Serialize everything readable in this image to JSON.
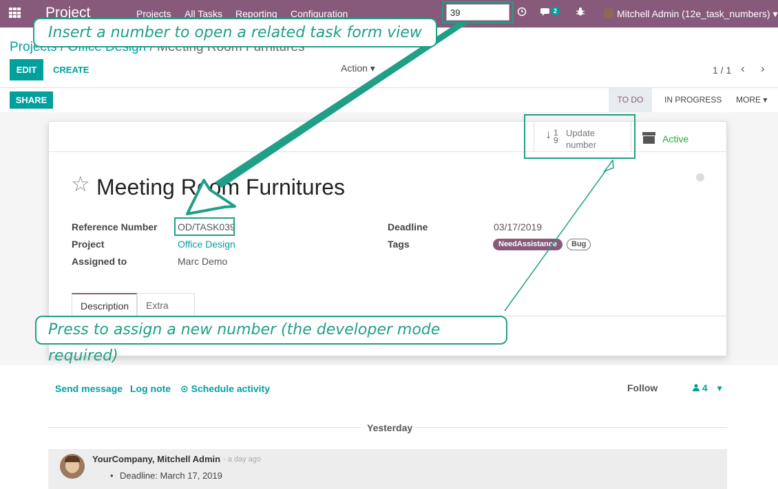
{
  "navbar": {
    "brand": "Project",
    "menu": [
      "Projects",
      "All Tasks",
      "Reporting",
      "Configuration"
    ],
    "quick_search_value": "39",
    "messages_count": "2",
    "user_name": "Mitchell Admin (12e_task_numbers)",
    "user_caret": "▾"
  },
  "breadcrumb": {
    "items": [
      "Projects",
      "Office Design",
      "Meeting Room Furnitures"
    ],
    "separator": "/"
  },
  "controls": {
    "edit_label": "EDIT",
    "create_label": "CREATE",
    "action_label": "Action ▾",
    "pager_value": "1 / 1",
    "prev": "‹",
    "next": "›",
    "share_label": "SHARE"
  },
  "stages": {
    "todo": "TO DO",
    "in_progress": "IN PROGRESS",
    "more": "MORE ▾"
  },
  "smart_buttons": {
    "update_icon_top": "1",
    "update_icon_bottom": "9",
    "update_label": "Update number",
    "active_label": "Active"
  },
  "task": {
    "star": "☆",
    "title": "Meeting Room Furnitures",
    "fields": {
      "reference_label": "Reference Number",
      "reference_value": "OD/TASK039",
      "project_label": "Project",
      "project_value": "Office Design",
      "assigned_label": "Assigned to",
      "assigned_value": "Marc Demo",
      "deadline_label": "Deadline",
      "deadline_value": "03/17/2019",
      "tags_label": "Tags",
      "tags": [
        "NeedAssistance",
        "Bug"
      ]
    },
    "tabs": [
      "Description",
      "Extra Info"
    ]
  },
  "callouts": {
    "top": "Insert a number to open a related task form view",
    "bottom": "Press to assign a new number (the developer mode required)"
  },
  "chatter": {
    "send_message": "Send message",
    "log_note": "Log note",
    "schedule_activity": "Schedule activity",
    "schedule_icon": "⊙",
    "follow": "Follow",
    "followers_count": "4",
    "followers_caret": "▾",
    "day_separator": "Yesterday",
    "message": {
      "author": "YourCompany, Mitchell Admin",
      "time": "- a day ago",
      "bullet": "•",
      "body": "Deadline: March 17, 2019"
    }
  },
  "colors": {
    "navbar": "#875A7B",
    "accent": "#00A09D",
    "annotation": "#1f9f86",
    "active": "#28a745"
  }
}
